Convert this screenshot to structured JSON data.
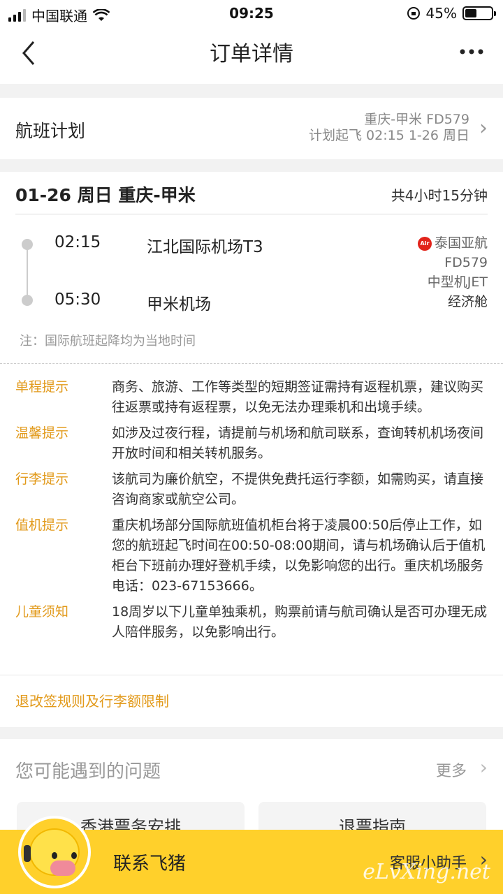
{
  "status": {
    "carrier": "中国联通",
    "time": "09:25",
    "battery": "45%",
    "battery_level": 0.45
  },
  "nav": {
    "title": "订单详情",
    "back_icon": "chevron-left-icon",
    "more_icon": "more-icon"
  },
  "plan": {
    "label": "航班计划",
    "route": "重庆-甲米 FD579",
    "schedule": "计划起飞 02:15 1-26 周日"
  },
  "flight": {
    "header": "01-26 周日 重庆-甲米",
    "duration": "共4小时15分钟",
    "depart": {
      "time": "02:15",
      "airport": "江北国际机场T3"
    },
    "arrive": {
      "time": "05:30",
      "airport": "甲米机场"
    },
    "airline": {
      "name": "泰国亚航",
      "logo_text": "AirAsia",
      "flight_no": "FD579",
      "aircraft": "中型机JET",
      "cabin": "经济舱"
    },
    "note": "注：国际航班起降均为当地时间"
  },
  "tips": [
    {
      "key": "单程提示",
      "text": "商务、旅游、工作等类型的短期签证需持有返程机票，建议购买往返票或持有返程票，以免无法办理乘机和出境手续。"
    },
    {
      "key": "温馨提示",
      "text": "如涉及过夜行程，请提前与机场和航司联系，查询转机机场夜间开放时间和相关转机服务。"
    },
    {
      "key": "行李提示",
      "text": "该航司为廉价航空，不提供免费托运行李额，如需购买，请直接咨询商家或航空公司。"
    },
    {
      "key": "值机提示",
      "text": "重庆机场部分国际航班值机柜台将于凌晨00:50后停止工作，如您的航班起飞时间在00:50-08:00期间，请与机场确认后于值机柜台下班前办理好登机手续，以免影响您的出行。重庆机场服务电话：023-67153666。"
    },
    {
      "key": "儿童须知",
      "text": "18周岁以下儿童单独乘机，购票前请与航司确认是否可办理无成人陪伴服务，以免影响出行。"
    }
  ],
  "rules_link": "退改签规则及行李额限制",
  "faq": {
    "title": "您可能遇到的问题",
    "more": "更多",
    "buttons": [
      "香港票务安排",
      "退票指南"
    ]
  },
  "bottom": {
    "contact": "联系飞猪",
    "assistant": "客服小助手",
    "watermark": "eLvXing.net"
  },
  "colors": {
    "accent": "#e29a1b",
    "bar": "#ffd02b",
    "airline_red": "#e2231a"
  }
}
